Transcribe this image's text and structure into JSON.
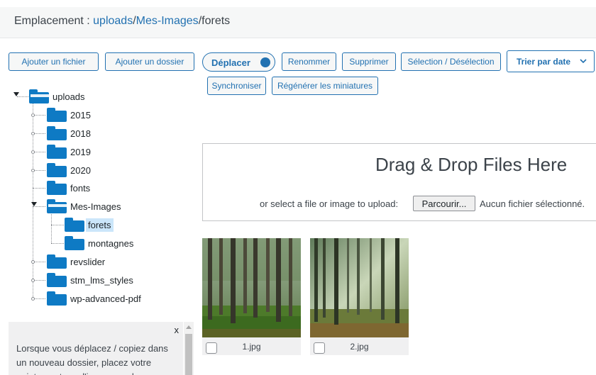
{
  "location": {
    "prefix": "Emplacement : ",
    "crumb_root": "uploads",
    "sep1": "/",
    "crumb_mid": "Mes-Images",
    "sep2": "/",
    "current": "forets"
  },
  "toolbar": {
    "add_file": "Ajouter un fichier",
    "add_folder": "Ajouter un dossier",
    "move_toggle": "Déplacer",
    "rename": "Renommer",
    "delete": "Supprimer",
    "select_toggle": "Sélection / Désélection",
    "sort_value": "Trier par date",
    "sync": "Synchroniser",
    "regenerate": "Régénérer les miniatures"
  },
  "tree": {
    "root": "uploads",
    "items": [
      "2015",
      "2018",
      "2019",
      "2020",
      "fonts",
      "Mes-Images",
      "forets",
      "montagnes",
      "revslider",
      "stm_lms_styles",
      "wp-advanced-pdf"
    ],
    "selected": "forets"
  },
  "help": {
    "close": "x",
    "text": "Lorsque vous déplacez / copiez dans un nouveau dossier, placez votre pointeur, et non l'image, sur le"
  },
  "upload": {
    "title": "Drag & Drop Files Here",
    "hint": "or select a file or image to upload:",
    "browse": "Parcourir...",
    "no_file": "Aucun fichier sélectionné."
  },
  "files": [
    {
      "name": "1.jpg",
      "icon": "forest-photo"
    },
    {
      "name": "2.jpg",
      "icon": "forest-photo"
    }
  ],
  "colors": {
    "accent": "#2271b1",
    "folder": "#0e7ac4",
    "selected": "#cbe6fa"
  }
}
